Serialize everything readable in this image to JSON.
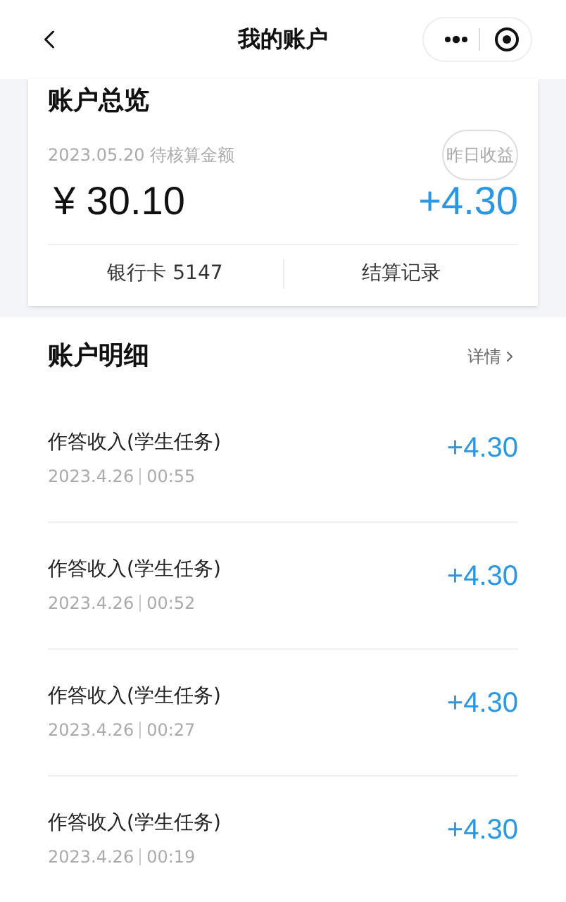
{
  "nav": {
    "title": "我的账户"
  },
  "overview": {
    "title": "账户总览",
    "pending_label": "2023.05.20 待核算金额",
    "pending_amount": "¥ 30.10",
    "yesterday_label": "昨日收益",
    "yesterday_amount": "+4.30",
    "links": [
      {
        "label": "银行卡 5147"
      },
      {
        "label": "结算记录"
      }
    ]
  },
  "details": {
    "title": "账户明细",
    "more": "详情",
    "rows": [
      {
        "title": "作答收入(学生任务)",
        "date": "2023.4.26",
        "time": "00:55",
        "amount": "+4.30"
      },
      {
        "title": "作答收入(学生任务)",
        "date": "2023.4.26",
        "time": "00:52",
        "amount": "+4.30"
      },
      {
        "title": "作答收入(学生任务)",
        "date": "2023.4.26",
        "time": "00:27",
        "amount": "+4.30"
      },
      {
        "title": "作答收入(学生任务)",
        "date": "2023.4.26",
        "time": "00:19",
        "amount": "+4.30"
      }
    ]
  }
}
